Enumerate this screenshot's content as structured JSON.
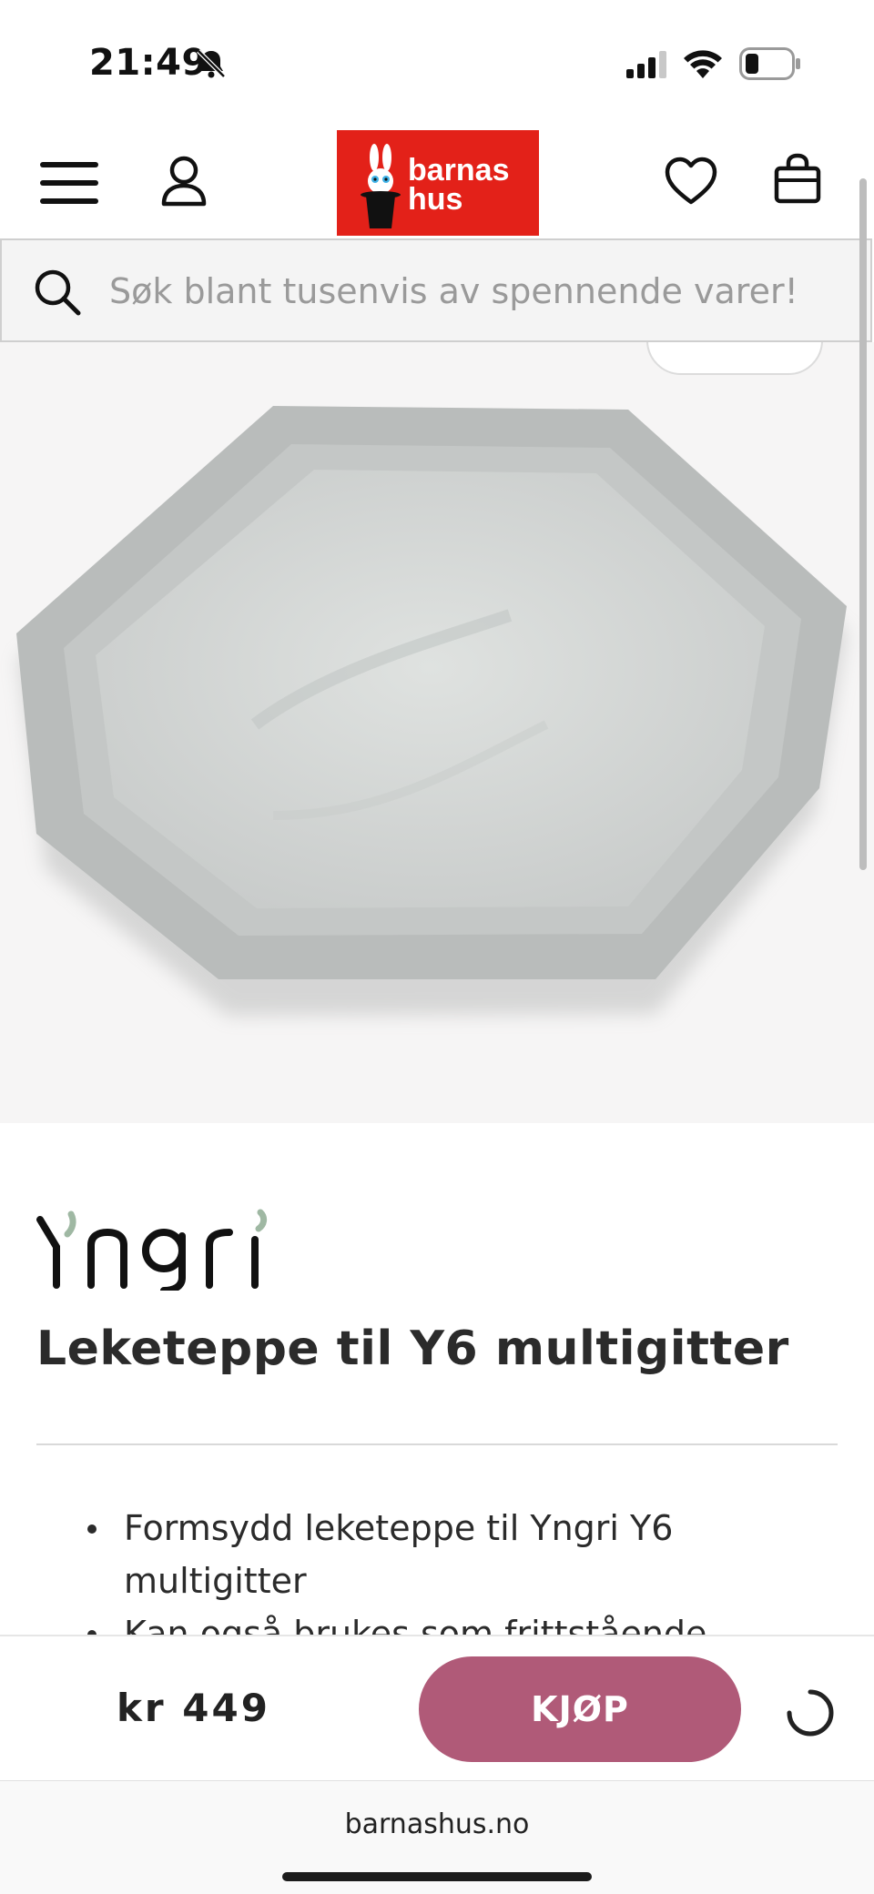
{
  "status_bar": {
    "time": "21:49",
    "icons": [
      "bell-slash-icon",
      "signal-icon",
      "wifi-icon",
      "battery-icon"
    ]
  },
  "header": {
    "logo_line1": "barnas",
    "logo_line2": "hus",
    "logo_color": "#e32119",
    "icons": [
      "menu-icon",
      "account-icon",
      "heart-icon",
      "bag-icon"
    ]
  },
  "search": {
    "placeholder": "Søk blant tusenvis av spennende varer!"
  },
  "product": {
    "brand": "Yngri",
    "title": "Leketeppe til Y6 multigitter",
    "bullets": [
      "Formsydd leketeppe til Yngri Y6 multigitter",
      "Kan også brukes som frittstående"
    ]
  },
  "buy_bar": {
    "price": "kr 449",
    "buy_label": "KJØP",
    "button_color": "#b05a78"
  },
  "browser": {
    "url": "barnashus.no"
  }
}
